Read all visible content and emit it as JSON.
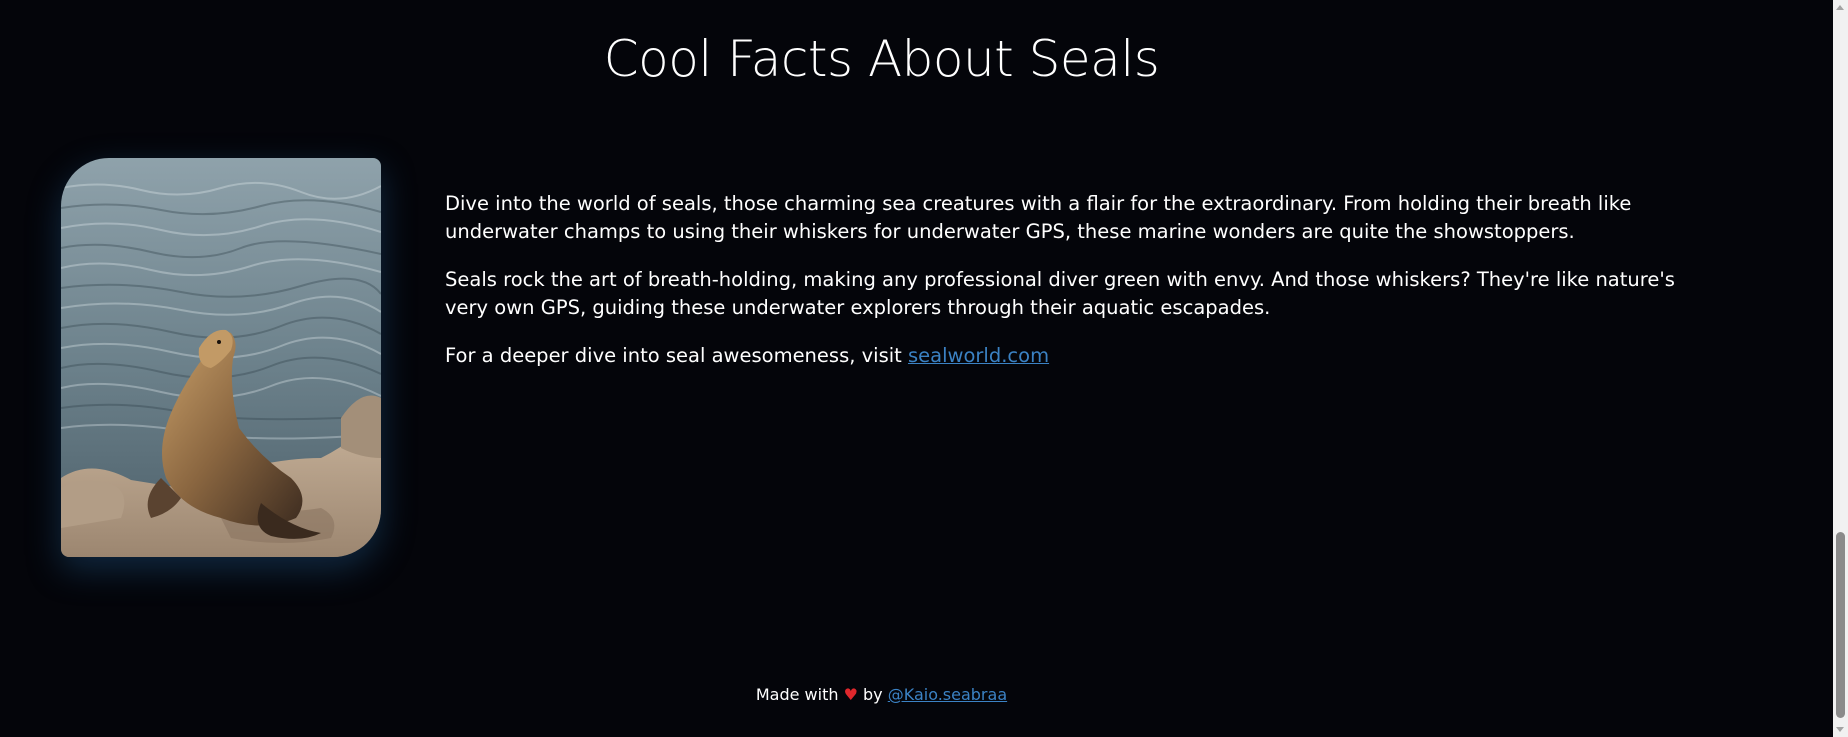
{
  "page": {
    "title": "Cool Facts About Seals"
  },
  "image": {
    "alt": "seal-photo"
  },
  "content": {
    "paragraphs": [
      "Dive into the world of seals, those charming sea creatures with a flair for the extraordinary. From holding their breath like underwater champs to using their whiskers for underwater GPS, these marine wonders are quite the showstoppers.",
      "Seals rock the art of breath-holding, making any professional diver green with envy. And those whiskers? They're like nature's very own GPS, guiding these underwater explorers through their aquatic escapades."
    ],
    "visit_prefix": "For a deeper dive into seal awesomeness, visit ",
    "visit_link": "sealworld.com"
  },
  "footer": {
    "made_with": "Made with ",
    "heart": "♥",
    "by": " by ",
    "author_link": "@Kaio.seabraa"
  },
  "colors": {
    "background": "#04050a",
    "link": "#3b82c4",
    "heart": "#e0272c"
  }
}
